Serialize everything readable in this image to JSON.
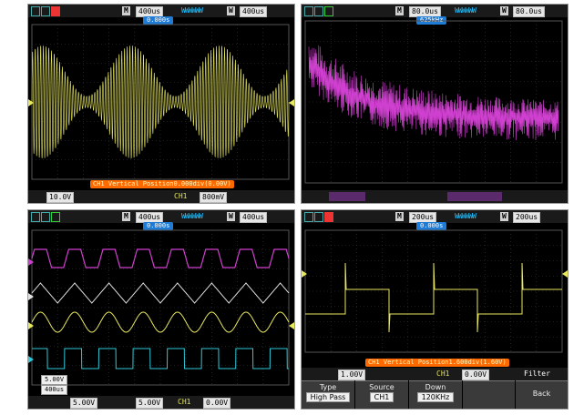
{
  "panels": {
    "p1": {
      "menu_m": "M",
      "timebase": "400us",
      "menu_w": "W",
      "window_timebase": "400us",
      "trigger_offset": "0.000s",
      "status_msg": "CH1 Vertical Position0.000div(0.00V)",
      "bottom_left": "10.0V",
      "bottom_ch": "CH1",
      "bottom_trig_level": "800mV"
    },
    "p2": {
      "menu_m": "M",
      "timebase": "80.0us",
      "menu_w": "W",
      "window_timebase": "80.0us",
      "trigger_offset": "625kHz"
    },
    "p3": {
      "menu_m": "M",
      "timebase": "400us",
      "menu_w": "W",
      "window_timebase": "400us",
      "trigger_offset": "0.000s",
      "level_top": "5.00V",
      "level_bottom": "400us",
      "bottom_v1": "5.00V",
      "bottom_v2": "5.00V",
      "bottom_ch": "CH1",
      "bottom_trig_level": "0.00V"
    },
    "p4": {
      "menu_m": "M",
      "timebase": "200us",
      "menu_w": "W",
      "window_timebase": "200us",
      "trigger_offset": "0.000s",
      "status_msg": "CH1 Vertical Position1.600div(1.60V)",
      "bottom_left": "1.00V",
      "bottom_ch": "CH1",
      "bottom_trig_level": "0.00V",
      "filter_title": "Filter",
      "softkeys": [
        {
          "title": "Type",
          "value": "High Pass"
        },
        {
          "title": "Source",
          "value": "CH1"
        },
        {
          "title": "Down",
          "value": "120KHz"
        }
      ],
      "back_label": "Back"
    }
  },
  "colors": {
    "ch1": "#e8e860",
    "ch2": "#30c8d8",
    "math": "#d040d0",
    "ref": "#e0e0e0",
    "grid": "#3a3a3a",
    "badge": "#1e7bd6",
    "status": "#ff6a00"
  }
}
